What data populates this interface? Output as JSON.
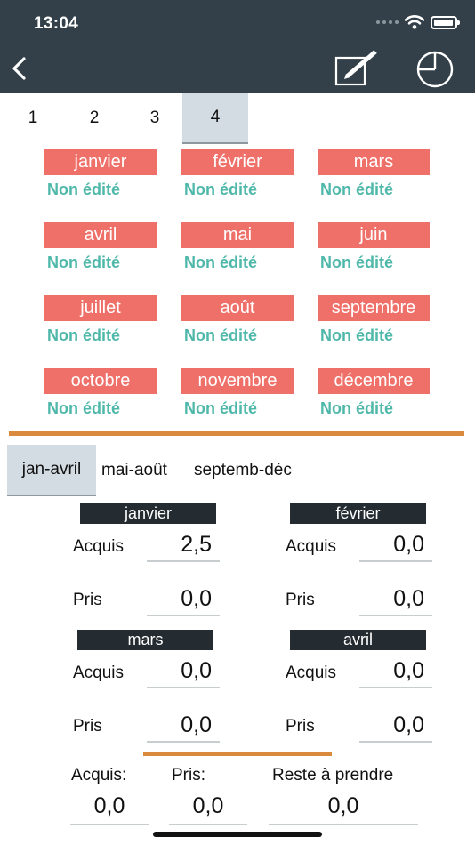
{
  "status_bar": {
    "time": "13:04"
  },
  "nav": {
    "back_icon": "chevron-left-icon",
    "edit_icon": "edit-note-icon",
    "chart_icon": "pie-chart-icon"
  },
  "page_tabs": [
    {
      "label": "1",
      "active": false
    },
    {
      "label": "2",
      "active": false
    },
    {
      "label": "3",
      "active": false
    },
    {
      "label": "4",
      "active": true
    }
  ],
  "months": [
    {
      "name": "janvier",
      "status": "Non édité"
    },
    {
      "name": "février",
      "status": "Non édité"
    },
    {
      "name": "mars",
      "status": "Non édité"
    },
    {
      "name": "avril",
      "status": "Non édité"
    },
    {
      "name": "mai",
      "status": "Non édité"
    },
    {
      "name": "juin",
      "status": "Non édité"
    },
    {
      "name": "juillet",
      "status": "Non édité"
    },
    {
      "name": "août",
      "status": "Non édité"
    },
    {
      "name": "septembre",
      "status": "Non édité"
    },
    {
      "name": "octobre",
      "status": "Non édité"
    },
    {
      "name": "novembre",
      "status": "Non édité"
    },
    {
      "name": "décembre",
      "status": "Non édité"
    }
  ],
  "range_tabs": [
    {
      "label": "jan-avril",
      "active": true
    },
    {
      "label": "mai-août",
      "active": false
    },
    {
      "label": "septemb-déc",
      "active": false
    }
  ],
  "details": [
    {
      "month": "janvier",
      "acquis_label": "Acquis",
      "acquis": "2,5",
      "pris_label": "Pris",
      "pris": "0,0"
    },
    {
      "month": "février",
      "acquis_label": "Acquis",
      "acquis": "0,0",
      "pris_label": "Pris",
      "pris": "0,0"
    },
    {
      "month": "mars",
      "acquis_label": "Acquis",
      "acquis": "0,0",
      "pris_label": "Pris",
      "pris": "0,0"
    },
    {
      "month": "avril",
      "acquis_label": "Acquis",
      "acquis": "0,0",
      "pris_label": "Pris",
      "pris": "0,0"
    }
  ],
  "totals": {
    "acquis_label": "Acquis:",
    "acquis": "0,0",
    "pris_label": "Pris:",
    "pris": "0,0",
    "reste_label": "Reste à prendre",
    "reste": "0,0"
  },
  "colors": {
    "header": "#334049",
    "month_label": "#ef6f69",
    "status_text": "#4fb8aa",
    "divider": "#d98a3c",
    "detail_header": "#242b31",
    "active_tab": "#d4dce3"
  }
}
